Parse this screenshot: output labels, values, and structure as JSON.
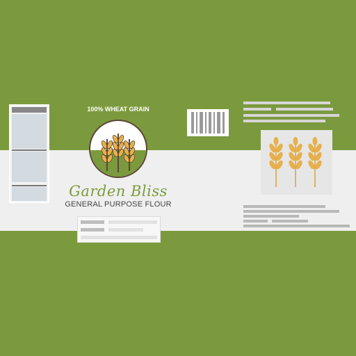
{
  "label": {
    "tagline": "100% WHEAT GRAIN",
    "brand": "Garden Bliss",
    "product": "GENERAL PURPOSE FLOUR"
  },
  "icons": {
    "logo": "wheat-emblem-icon",
    "image": "wheat-stalks-icon",
    "barcode": "barcode-icon"
  },
  "colors": {
    "green": "#7b9a3d",
    "band": "#efefef",
    "wheat": "#e8b04c",
    "stem": "#5a4634"
  }
}
